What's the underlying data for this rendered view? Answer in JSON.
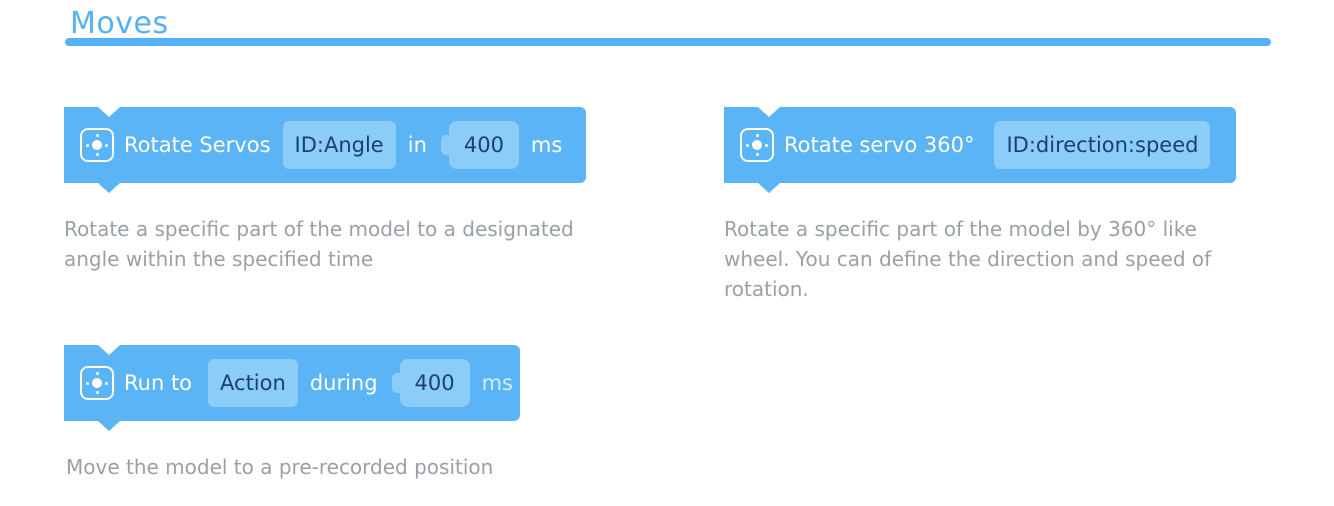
{
  "section": {
    "title": "Moves"
  },
  "blocks": [
    {
      "id": "rotate-servos",
      "icon": "servo-icon",
      "label": "Rotate Servos",
      "param_field": "ID:Angle",
      "connector": "in",
      "number_value": "400",
      "unit": "ms",
      "description": "Rotate a specific part of the model to a designated angle within the specified time"
    },
    {
      "id": "rotate-servo-360",
      "icon": "servo-icon",
      "label": "Rotate servo 360°",
      "param_field": "ID:direction:speed",
      "description": "Rotate a specific part of the model by 360° like wheel. You can define the direction and speed of rotation."
    },
    {
      "id": "run-to",
      "icon": "servo-icon",
      "label": "Run to",
      "param_field": "Action",
      "connector": "during",
      "number_value": "400",
      "unit": "ms",
      "description": "Move the model to a pre-recorded position"
    }
  ],
  "colors": {
    "accent": "#55b1f3",
    "block": "#5ab4f5",
    "field": "#8cccf8",
    "field_text": "#1b3f73",
    "description_text": "#9aa0a6"
  }
}
